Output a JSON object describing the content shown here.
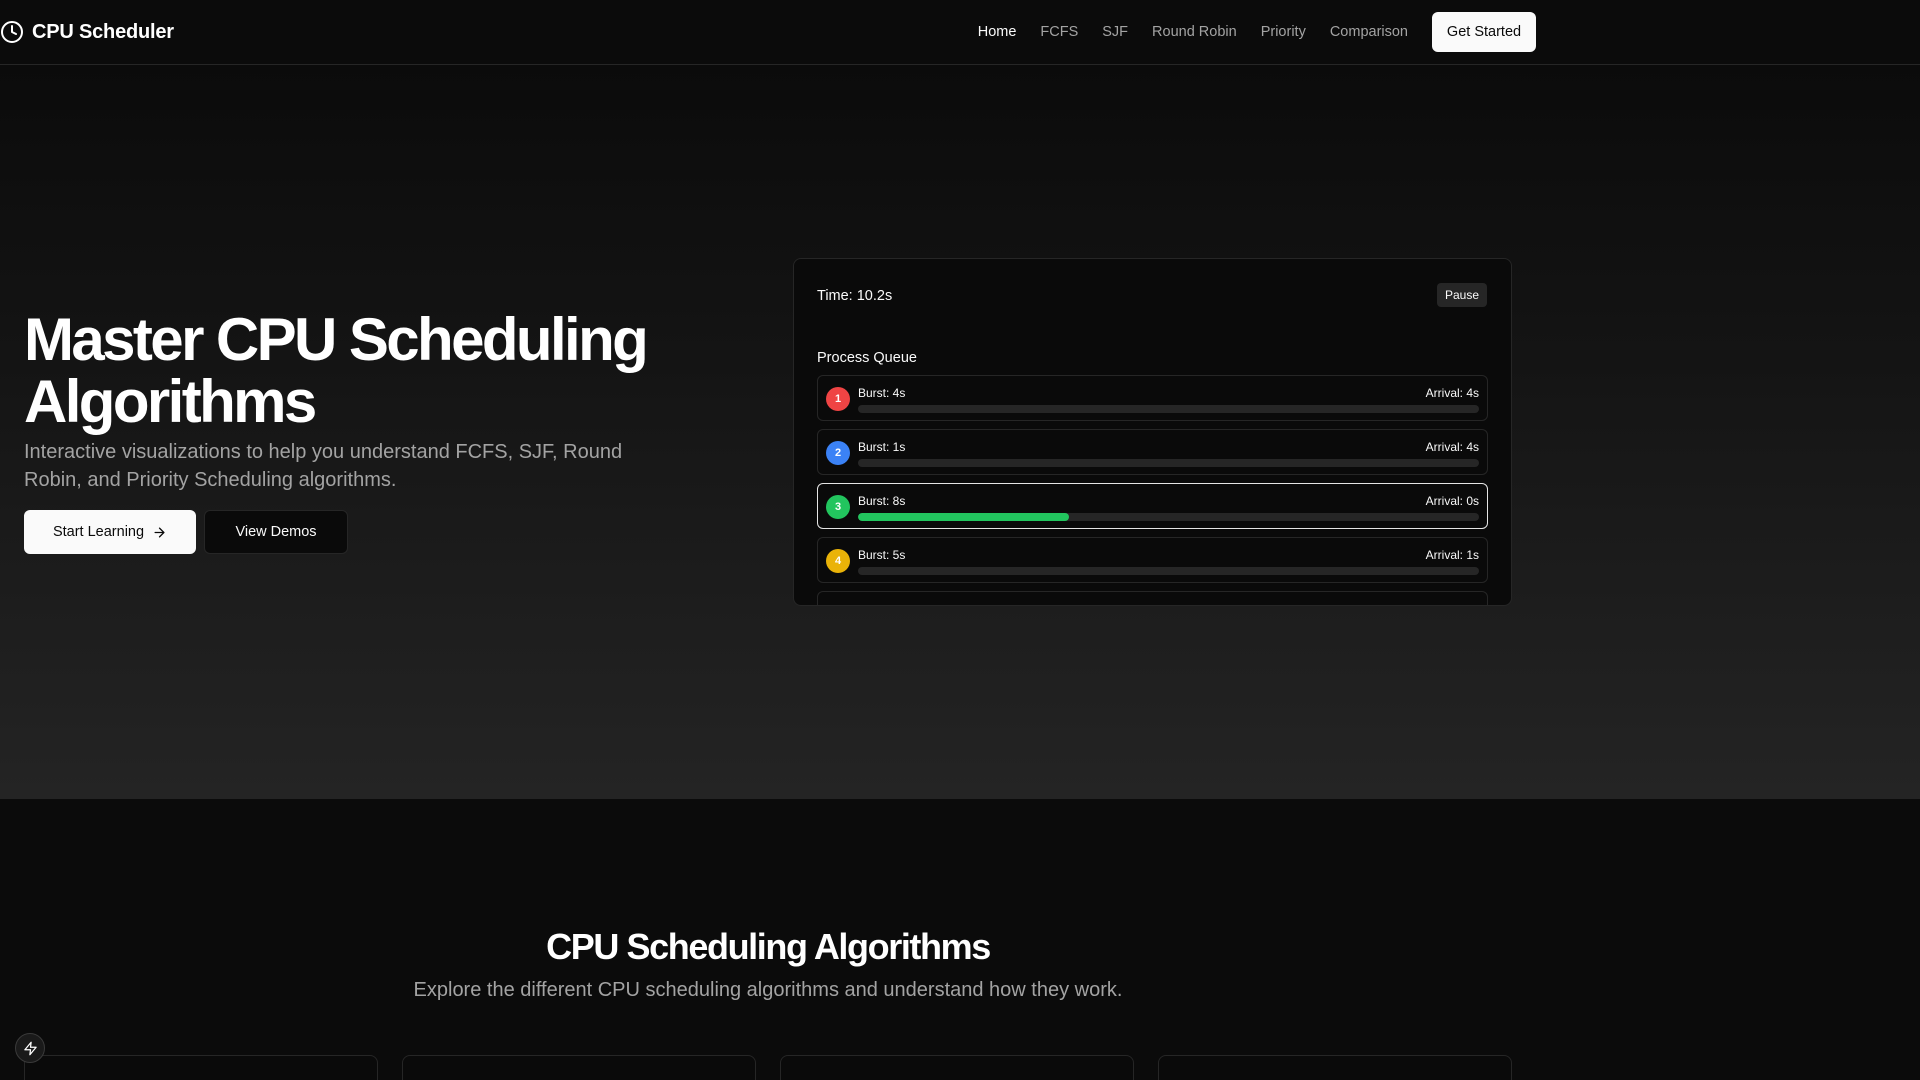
{
  "header": {
    "brand": "CPU Scheduler",
    "nav": [
      {
        "label": "Home",
        "active": true
      },
      {
        "label": "FCFS",
        "active": false
      },
      {
        "label": "SJF",
        "active": false
      },
      {
        "label": "Round Robin",
        "active": false
      },
      {
        "label": "Priority",
        "active": false
      },
      {
        "label": "Comparison",
        "active": false
      }
    ],
    "cta_label": "Get Started"
  },
  "hero": {
    "title": "Master CPU Scheduling Algorithms",
    "subtitle": "Interactive visualizations to help you understand FCFS, SJF, Round Robin, and Priority Scheduling algorithms.",
    "primary_button": "Start Learning",
    "secondary_button": "View Demos"
  },
  "simulator": {
    "time_label": "Time: 10.2s",
    "pause_label": "Pause",
    "queue_label": "Process Queue",
    "processes": [
      {
        "id": "1",
        "burst": "Burst: 4s",
        "arrival": "Arrival: 4s",
        "color": "#ef4444",
        "progress": 0,
        "active": false
      },
      {
        "id": "2",
        "burst": "Burst: 1s",
        "arrival": "Arrival: 4s",
        "color": "#3b82f6",
        "progress": 0,
        "active": false
      },
      {
        "id": "3",
        "burst": "Burst: 8s",
        "arrival": "Arrival: 0s",
        "color": "#22c55e",
        "progress": 0.34,
        "active": true
      },
      {
        "id": "4",
        "burst": "Burst: 5s",
        "arrival": "Arrival: 1s",
        "color": "#eab308",
        "progress": 0,
        "active": false
      }
    ]
  },
  "algorithms": {
    "title": "CPU Scheduling Algorithms",
    "subtitle": "Explore the different CPU scheduling algorithms and understand how they work."
  },
  "theme": {
    "background": "#0b0b0b",
    "foreground": "#fafafa",
    "muted": "#a3a3a3",
    "border": "#262626"
  }
}
